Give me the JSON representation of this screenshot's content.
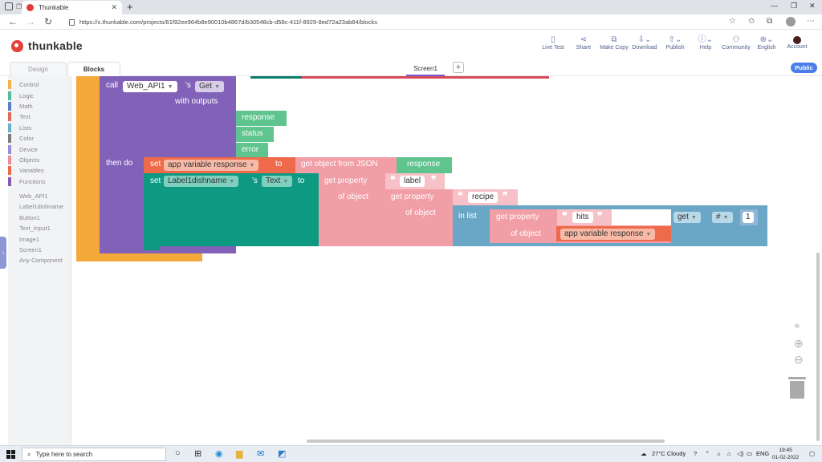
{
  "browser": {
    "tab_title": "Thunkable",
    "url": "https://x.thunkable.com/projects/61f92ee964b8e90010b4867d/b30548cb-d58c-411f-8929-8ed72a23ab84/blocks"
  },
  "app": {
    "brand": "thunkable",
    "tools": [
      {
        "label": "Live Test",
        "icon": "phone-icon"
      },
      {
        "label": "Share",
        "icon": "share-icon"
      },
      {
        "label": "Make Copy",
        "icon": "copy-icon"
      },
      {
        "label": "Download",
        "icon": "download-icon"
      },
      {
        "label": "Publish",
        "icon": "publish-icon"
      },
      {
        "label": "Help",
        "icon": "help-icon"
      },
      {
        "label": "Community",
        "icon": "community-icon"
      },
      {
        "label": "English",
        "icon": "globe-icon"
      },
      {
        "label": "Account",
        "icon": "account-icon"
      }
    ]
  },
  "tabs": {
    "design": "Design",
    "blocks": "Blocks",
    "screen": "Screen1",
    "add": "+",
    "public": "Public"
  },
  "toolbox": {
    "categories": [
      {
        "label": "Control",
        "color": "#f0b24a"
      },
      {
        "label": "Logic",
        "color": "#59b99b"
      },
      {
        "label": "Math",
        "color": "#5b80c2"
      },
      {
        "label": "Text",
        "color": "#e0685a"
      },
      {
        "label": "Lists",
        "color": "#6ab1c9"
      },
      {
        "label": "Color",
        "color": "#7d7d7d"
      },
      {
        "label": "Device",
        "color": "#9d8dd4"
      },
      {
        "label": "Objects",
        "color": "#e88d99"
      },
      {
        "label": "Variables",
        "color": "#ee6a4a"
      },
      {
        "label": "Functions",
        "color": "#8b5bb0"
      }
    ],
    "components": [
      "Web_API1",
      "Label1dishname",
      "Button1",
      "Text_Input1",
      "Image1",
      "Screen1",
      "Any Component"
    ]
  },
  "blocks": {
    "call": "call",
    "web_api": "Web_API1",
    "s": "'s",
    "get": "Get",
    "with_outputs": "with outputs",
    "response": "response",
    "status": "status",
    "error": "error",
    "then_do": "then do",
    "set": "set",
    "app_var": "app variable response",
    "to": "to",
    "get_obj_json": "get object from JSON",
    "response_arg": "response",
    "set2": "set",
    "label_comp": "Label1dishname",
    "s2": "'s",
    "text_prop": "Text",
    "to2": "to",
    "get_property": "get property",
    "label_str": "label",
    "of_object": "of object",
    "get_property2": "get property",
    "recipe_str": "recipe",
    "of_object2": "of object",
    "of_object3": "of object",
    "in_list": "in list",
    "get_property3": "get property",
    "hits_str": "hits",
    "of_object4": "of object",
    "app_var2": "app variable response",
    "get_op": "get",
    "hash": "#",
    "index": "1"
  },
  "taskbar": {
    "search_placeholder": "Type here to search",
    "weather": "27°C  Cloudy",
    "lang": "ENG",
    "time": "19:45",
    "date": "01-02-2022"
  }
}
